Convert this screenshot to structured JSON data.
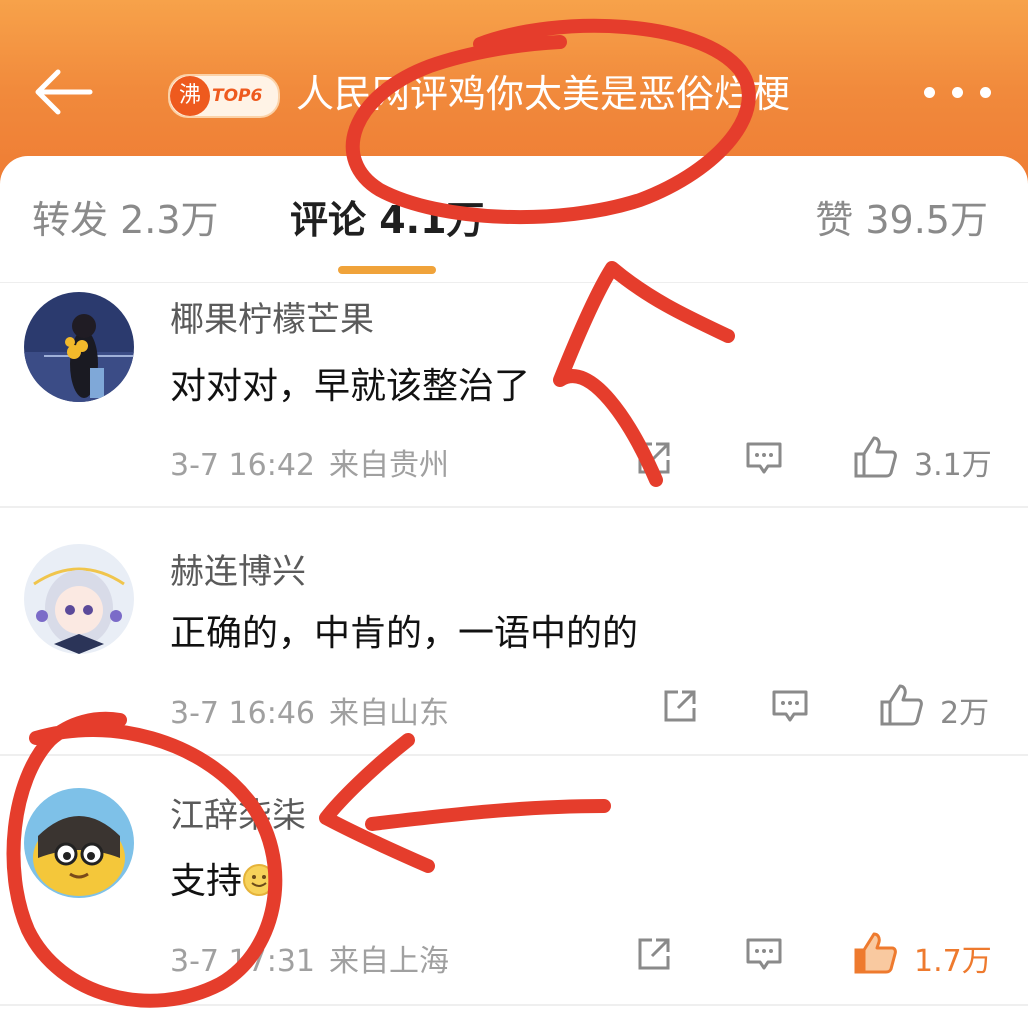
{
  "header": {
    "hot_badge_char": "沸",
    "hot_badge_rank": "TOP6",
    "title": "人民网评鸡你太美是恶俗烂梗"
  },
  "tabs": {
    "repost": "转发 2.3万",
    "comment": "评论 4.1万",
    "like": "赞 39.5万"
  },
  "comments": [
    {
      "username": "椰果柠檬芒果",
      "content": "对对对，早就该整治了",
      "time": "3-7 16:42",
      "location": "来自贵州",
      "likes": "3.1万",
      "liked": false
    },
    {
      "username": "赫连博兴",
      "content": "正确的，中肯的，一语中的的",
      "time": "3-7 16:46",
      "location": "来自山东",
      "likes": "2万",
      "liked": false
    },
    {
      "username": "江辞柒柒",
      "content": "支持",
      "time": "3-7 17:31",
      "location": "来自上海",
      "likes": "1.7万",
      "liked": true
    }
  ],
  "colors": {
    "header_orange": "#ee7a33",
    "tab_underline": "#f0a33a",
    "liked_orange": "#ee7a2e",
    "annotation_red": "#e53d2c"
  },
  "icons": [
    "back-arrow-icon",
    "more-icon",
    "share-icon",
    "comment-icon",
    "thumb-up-icon",
    "smiley-emoji-icon"
  ]
}
